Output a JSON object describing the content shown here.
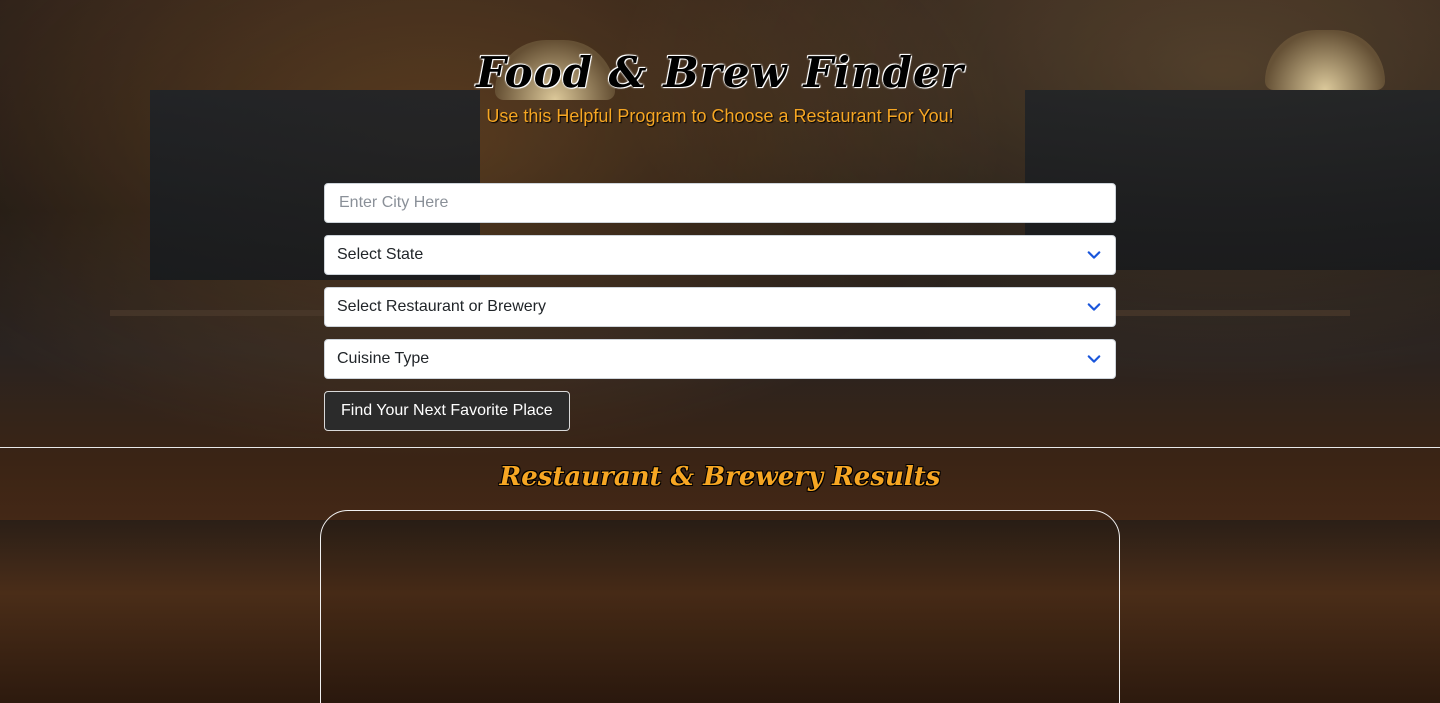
{
  "header": {
    "title": "Food & Brew Finder",
    "subtitle": "Use this Helpful Program to Choose a Restaurant For You!"
  },
  "form": {
    "city_placeholder": "Enter City Here",
    "state_select": "Select State",
    "type_select": "Select Restaurant or Brewery",
    "cuisine_select": "Cuisine Type",
    "submit_label": "Find Your Next Favorite Place"
  },
  "results": {
    "title": "Restaurant & Brewery Results"
  },
  "icons": {
    "chevron": "chevron-down-icon"
  },
  "colors": {
    "accent": "#f6a623",
    "chevron": "#1a56db",
    "button_bg": "#2b2b2b"
  }
}
